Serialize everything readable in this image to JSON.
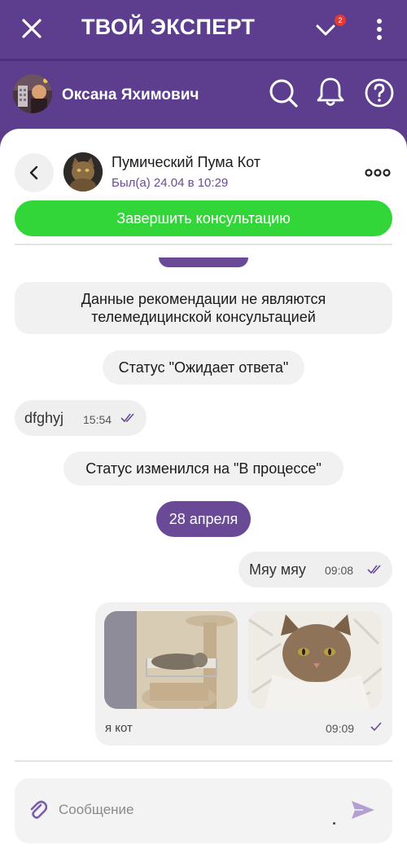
{
  "app": {
    "title": "ТВОЙ ЭКСПЕРТ",
    "close_icon": "close-icon",
    "dropdown_icon": "chevron-down-icon",
    "menu_icon": "kebab-menu-icon"
  },
  "user": {
    "name": "Оксана Яхимович",
    "notifications_count": "2"
  },
  "chat": {
    "contact_name": "Пумический Пума Кот",
    "last_seen": "Был(а) 24.04 в 10:29",
    "finish_label": "Завершить консультацию"
  },
  "messages": {
    "disclaimer_line1": "Данные рекомендации не являются",
    "disclaimer_line2": "телемедицинской консультацией",
    "status_waiting": "Статус \"Ожидает ответа\"",
    "incoming_text": "dfghyj",
    "incoming_time": "15:54",
    "status_changed": "Статус изменился на \"В процессе\"",
    "date_separator": "28 апреля",
    "outgoing_text": "Мяу мяу",
    "outgoing_time": "09:08",
    "photo_caption": "я кот",
    "photo_time": "09:09"
  },
  "composer": {
    "placeholder": "Сообщение"
  },
  "colors": {
    "brand_purple": "#5d3d8d",
    "accent_green": "#32d638",
    "badge_red": "#e53935",
    "bubble_grey": "#f1f1f1"
  }
}
